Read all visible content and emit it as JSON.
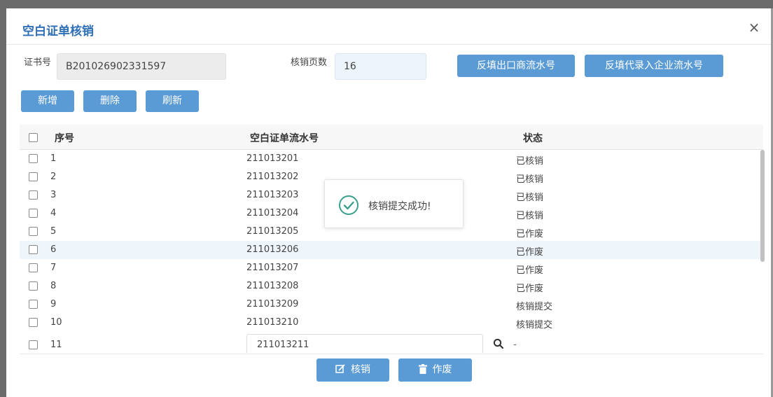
{
  "dialog": {
    "title": "空白证单核销",
    "close_symbol": "×"
  },
  "form": {
    "cert_no_label": "证书号",
    "cert_no_value": "B201026902331597",
    "pages_label": "核销页数",
    "pages_value": "16",
    "fill_exporter_button": "反填出口商流水号",
    "fill_agent_button": "反填代录入企业流水号"
  },
  "toolbar": {
    "add_label": "新增",
    "delete_label": "删除",
    "refresh_label": "刷新"
  },
  "table": {
    "columns": [
      "序号",
      "空白证单流水号",
      "状态"
    ],
    "rows": [
      {
        "no": "1",
        "serial": "211013201",
        "status": "已核销"
      },
      {
        "no": "2",
        "serial": "211013202",
        "status": "已核销"
      },
      {
        "no": "3",
        "serial": "211013203",
        "status": "已核销"
      },
      {
        "no": "4",
        "serial": "211013204",
        "status": "已核销"
      },
      {
        "no": "5",
        "serial": "211013205",
        "status": "已作废"
      },
      {
        "no": "6",
        "serial": "211013206",
        "status": "已作废"
      },
      {
        "no": "7",
        "serial": "211013207",
        "status": "已作废"
      },
      {
        "no": "8",
        "serial": "211013208",
        "status": "已作废"
      },
      {
        "no": "9",
        "serial": "211013209",
        "status": "核销提交"
      },
      {
        "no": "10",
        "serial": "211013210",
        "status": "核销提交"
      }
    ],
    "edit_row": {
      "no": "11",
      "serial": "211013211",
      "status": "-"
    }
  },
  "toast": {
    "message": "核销提交成功!",
    "icon": "check-circle-icon"
  },
  "footer": {
    "writeoff_label": "核销",
    "writeoff_icon": "edit-icon",
    "void_label": "作废",
    "void_icon": "trash-icon"
  },
  "colors": {
    "accent": "#5b9bd5",
    "title": "#2f6fb5",
    "success": "#3aa08c",
    "row_highlight": "#eef5fb"
  }
}
